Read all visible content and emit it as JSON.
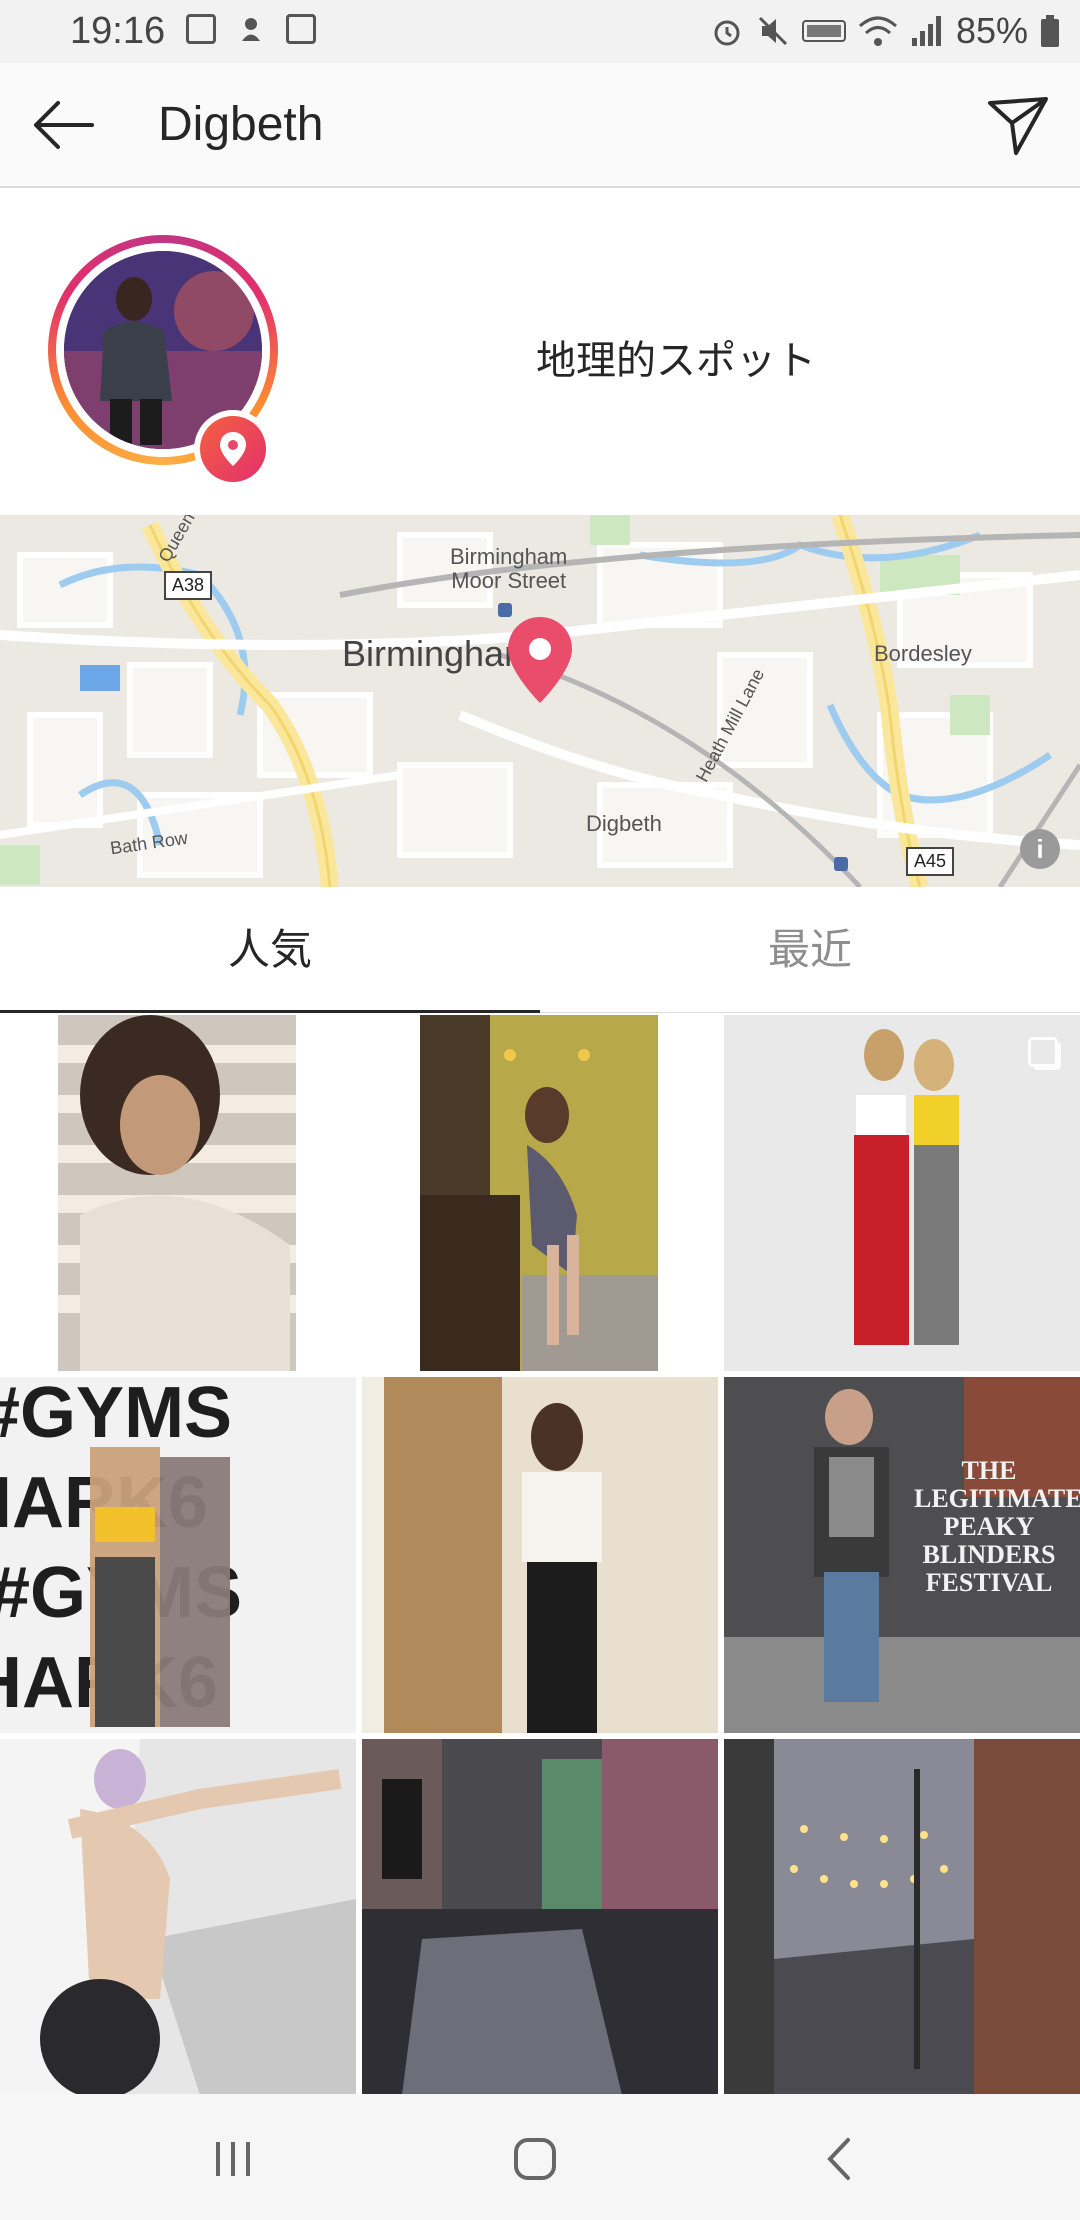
{
  "status_bar": {
    "time": "19:16",
    "battery": "85%"
  },
  "header": {
    "title": "Digbeth"
  },
  "profile": {
    "category": "地理的スポット"
  },
  "map": {
    "labels": {
      "birmingham": "Birmingham",
      "moor_street_line1": "Birmingham",
      "moor_street_line2": "Moor Street",
      "bordesley": "Bordesley",
      "digbeth": "Digbeth",
      "bath_row": "Bath Row",
      "heath_mill_lane": "Heath Mill Lane",
      "queensway": "Queen",
      "a38": "A38",
      "a45": "A45"
    },
    "info": "i"
  },
  "tabs": [
    {
      "label": "人気",
      "active": true
    },
    {
      "label": "最近",
      "active": false
    }
  ],
  "grid": {
    "tiles": [
      {
        "name": "curly-hair-shadow",
        "multi": true
      },
      {
        "name": "kitchen-pose",
        "multi": false
      },
      {
        "name": "two-women-wall",
        "multi": true
      },
      {
        "name": "gymshark-wall",
        "multi": false
      },
      {
        "name": "white-top-door",
        "multi": false
      },
      {
        "name": "peaky-blinders-festival",
        "multi": false,
        "caption": "THE LEGITIMATE PEAKY BLINDERS FESTIVAL"
      },
      {
        "name": "graffiti-pose",
        "multi": false
      },
      {
        "name": "rainy-street",
        "multi": false
      },
      {
        "name": "street-lights-alley",
        "multi": false
      }
    ]
  },
  "colors": {
    "accent": "#e1306c",
    "pin": "#ea4c6c",
    "text": "#262626",
    "muted": "#8e8e8e"
  }
}
